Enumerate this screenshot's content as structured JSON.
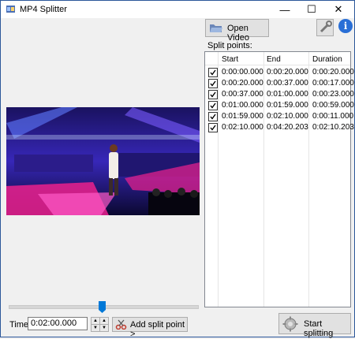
{
  "window": {
    "title": "MP4 Splitter",
    "minimize": "—",
    "maximize": "☐",
    "close": "✕"
  },
  "toolbar": {
    "open_video_label": "Open Video",
    "info_label": "i"
  },
  "split_points": {
    "label": "Split points:",
    "columns": [
      "Start",
      "End",
      "Duration"
    ],
    "rows": [
      {
        "checked": true,
        "start": "0:00:00.000",
        "end": "0:00:20.000",
        "duration": "0:00:20.000"
      },
      {
        "checked": true,
        "start": "0:00:20.000",
        "end": "0:00:37.000",
        "duration": "0:00:17.000"
      },
      {
        "checked": true,
        "start": "0:00:37.000",
        "end": "0:01:00.000",
        "duration": "0:00:23.000"
      },
      {
        "checked": true,
        "start": "0:01:00.000",
        "end": "0:01:59.000",
        "duration": "0:00:59.000"
      },
      {
        "checked": true,
        "start": "0:01:59.000",
        "end": "0:02:10.000",
        "duration": "0:00:11.000"
      },
      {
        "checked": true,
        "start": "0:02:10.000",
        "end": "0:04:20.203",
        "duration": "0:02:10.203"
      }
    ]
  },
  "player": {
    "position_fraction": 0.49
  },
  "time": {
    "label": "Time:",
    "value": "0:02:00.000"
  },
  "buttons": {
    "add_split_label": "Add split point >",
    "start_split_label": "Start splitting"
  },
  "colors": {
    "accent": "#0078d7",
    "stage_blue": "#3a3adf",
    "stage_pink": "#e0208c"
  }
}
